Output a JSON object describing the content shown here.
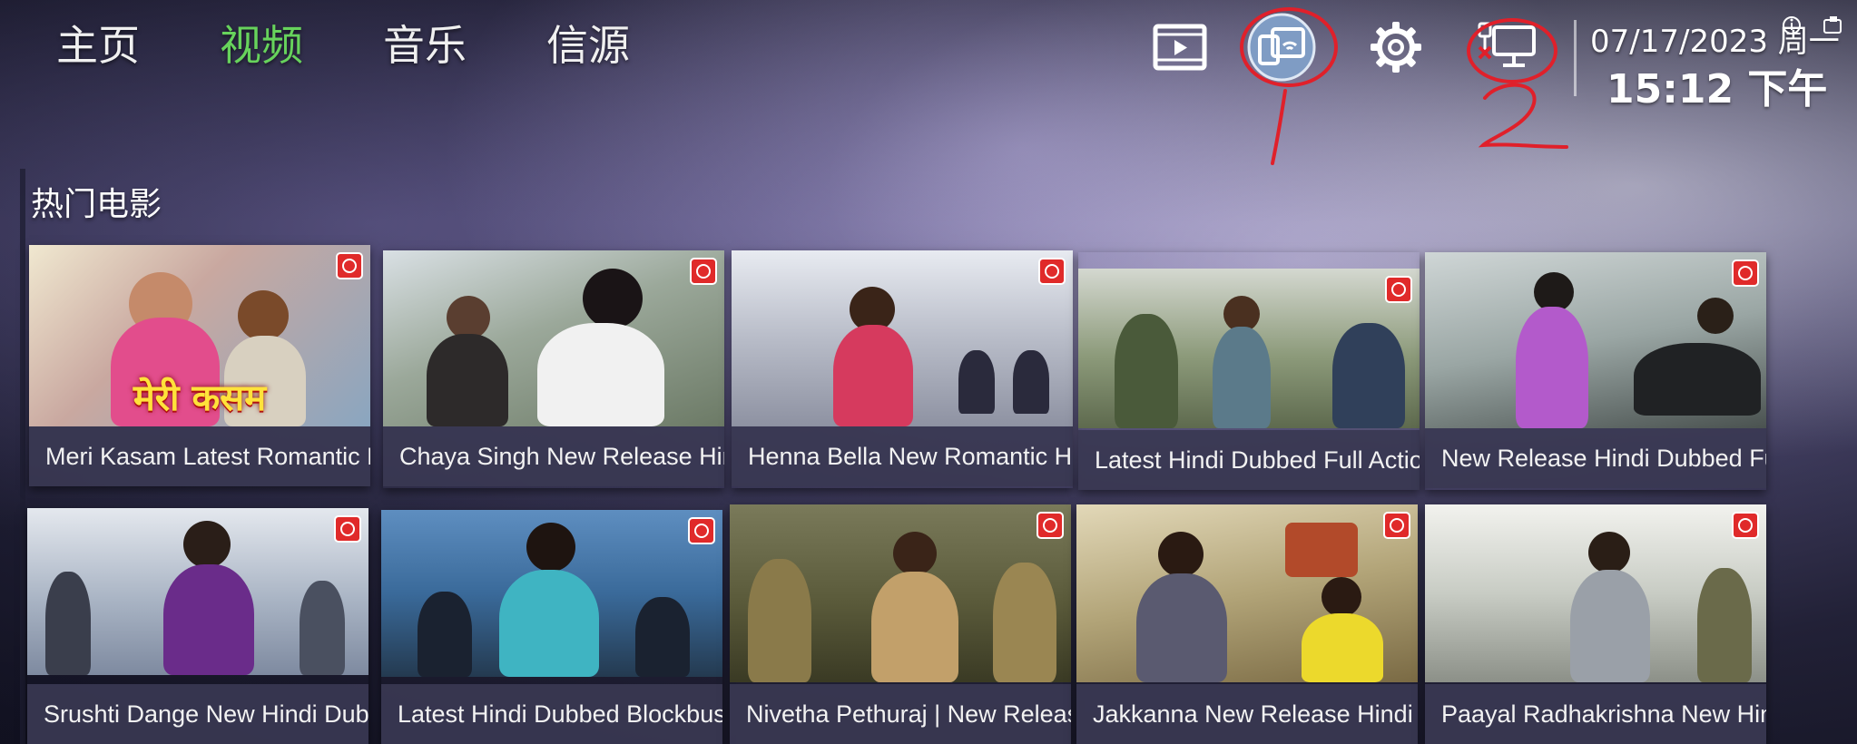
{
  "nav": {
    "tabs": [
      {
        "label": "主页",
        "active": false
      },
      {
        "label": "视频",
        "active": true
      },
      {
        "label": "音乐",
        "active": false
      },
      {
        "label": "信源",
        "active": false
      }
    ]
  },
  "toolbar": {
    "icons": [
      "video-player-icon",
      "screen-cast-icon",
      "settings-gear-icon",
      "network-disconnected-icon"
    ]
  },
  "clock": {
    "date": "07/17/2023 周一",
    "time": "15:12 下午"
  },
  "annotations": {
    "circle_1_label": "1",
    "circle_2_label": "2",
    "color": "#e0202a"
  },
  "section": {
    "title": "热门电影"
  },
  "movies": [
    {
      "title": "Meri Kasam Latest Romantic F",
      "overlay": "मेरी कसम"
    },
    {
      "title": "Chaya Singh New Release Hinc",
      "overlay": ""
    },
    {
      "title": "Henna Bella New Romantic Hir",
      "overlay": ""
    },
    {
      "title": "Latest Hindi Dubbed Full Actio",
      "overlay": ""
    },
    {
      "title": "New Release Hindi Dubbed Ful",
      "overlay": ""
    },
    {
      "title": "Srushti Dange New Hindi Dubb",
      "overlay": ""
    },
    {
      "title": "Latest Hindi Dubbed Blockbus",
      "overlay": ""
    },
    {
      "title": "Nivetha Pethuraj | New Releas",
      "overlay": ""
    },
    {
      "title": "Jakkanna New Release Hindi D",
      "overlay": ""
    },
    {
      "title": "Paayal Radhakrishna New Hinc",
      "overlay": ""
    }
  ],
  "colors": {
    "active_tab": "#67d35c",
    "title_bar": "#3a3852",
    "badge": "#e02a2a"
  }
}
